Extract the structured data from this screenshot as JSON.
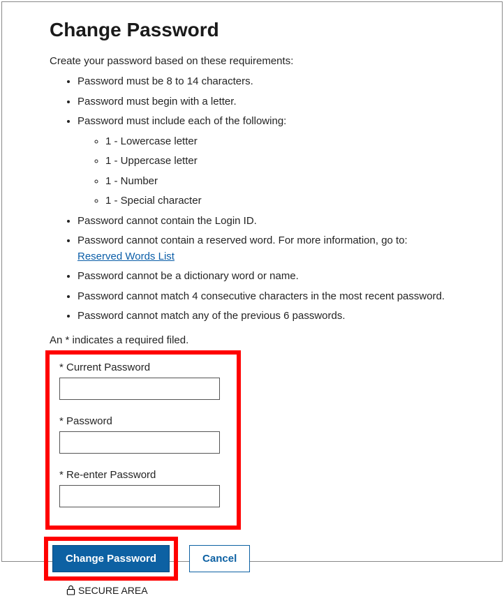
{
  "header": {
    "title": "Change Password"
  },
  "intro": "Create your password based on these requirements:",
  "requirements": [
    "Password must be 8 to 14 characters.",
    "Password must begin with a letter.",
    "Password must include each of the following:",
    "Password cannot contain the Login ID.",
    "Password cannot contain a reserved word. For more information, go to: ",
    "Password cannot be a dictionary word or name.",
    "Password cannot match 4 consecutive characters in the most recent password.",
    "Password cannot match any of the previous 6 passwords."
  ],
  "sub_requirements": [
    "1 - Lowercase letter",
    "1 - Uppercase letter",
    "1 - Number",
    "1 - Special character"
  ],
  "link": {
    "reserved_words": "Reserved Words List"
  },
  "required_note": "An * indicates a required filed.",
  "fields": {
    "current_label": "* Current Password",
    "password_label": "* Password",
    "reenter_label": "* Re-enter Password",
    "current_value": "",
    "password_value": "",
    "reenter_value": ""
  },
  "buttons": {
    "change": "Change Password",
    "cancel": "Cancel"
  },
  "footer": {
    "secure": "SECURE AREA"
  }
}
